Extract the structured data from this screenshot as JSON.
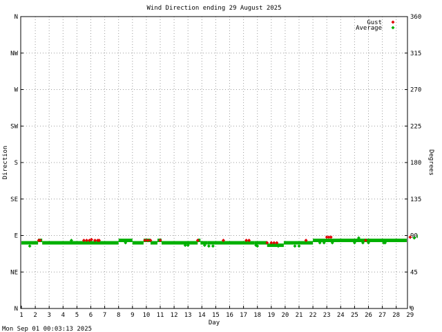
{
  "chart_data": {
    "type": "scatter",
    "title": "Wind Direction ending 29 August 2025",
    "xlabel": "Day",
    "ylabel_left": "Direction",
    "ylabel_right": "Degrees",
    "xlim": [
      1,
      30
    ],
    "ylim": [
      0,
      360
    ],
    "grid": true,
    "legend_position": "top-right",
    "x_ticks": [
      "1",
      "2",
      "3",
      "4",
      "5",
      "6",
      "7",
      "8",
      "9",
      "10",
      "11",
      "12",
      "13",
      "14",
      "15",
      "16",
      "17",
      "18",
      "19",
      "20",
      "21",
      "22",
      "23",
      "24",
      "25",
      "26",
      "27",
      "28",
      "29"
    ],
    "y_ticks_left": [
      {
        "value": 0,
        "label": "N"
      },
      {
        "value": 45,
        "label": "NE"
      },
      {
        "value": 90,
        "label": "E"
      },
      {
        "value": 135,
        "label": "SE"
      },
      {
        "value": 180,
        "label": "S"
      },
      {
        "value": 225,
        "label": "SW"
      },
      {
        "value": 270,
        "label": "W"
      },
      {
        "value": 315,
        "label": "NW"
      },
      {
        "value": 360,
        "label": "N"
      }
    ],
    "y_ticks_right": [
      {
        "value": 0,
        "label": "0"
      },
      {
        "value": 45,
        "label": "45"
      },
      {
        "value": 90,
        "label": "90"
      },
      {
        "value": 135,
        "label": "135"
      },
      {
        "value": 180,
        "label": "180"
      },
      {
        "value": 225,
        "label": "225"
      },
      {
        "value": 270,
        "label": "270"
      },
      {
        "value": 315,
        "label": "315"
      },
      {
        "value": 360,
        "label": "360"
      }
    ],
    "series": [
      {
        "name": "Gust",
        "color": "#e00000",
        "points": [
          [
            2.25,
            84
          ],
          [
            2.35,
            84
          ],
          [
            5.5,
            84
          ],
          [
            5.7,
            84
          ],
          [
            5.9,
            84
          ],
          [
            6.05,
            85
          ],
          [
            6.3,
            84
          ],
          [
            6.5,
            84
          ],
          [
            6.6,
            84
          ],
          [
            9.9,
            84
          ],
          [
            10.1,
            84
          ],
          [
            10.3,
            84
          ],
          [
            11.0,
            84
          ],
          [
            13.7,
            84
          ],
          [
            15.55,
            84
          ],
          [
            17.2,
            84
          ],
          [
            17.4,
            84
          ],
          [
            18.7,
            81
          ],
          [
            19.0,
            81
          ],
          [
            19.2,
            81
          ],
          [
            19.4,
            81
          ],
          [
            21.5,
            84
          ],
          [
            23.0,
            88
          ],
          [
            23.15,
            88
          ],
          [
            23.3,
            88
          ],
          [
            25.8,
            84
          ],
          [
            29.0,
            88
          ]
        ]
      },
      {
        "name": "Average",
        "color": "#00b000",
        "segments": [
          [
            1.0,
            2.2,
            81
          ],
          [
            2.2,
            2.5,
            84
          ],
          [
            2.5,
            8.0,
            81
          ],
          [
            8.0,
            9.0,
            84
          ],
          [
            9.0,
            9.8,
            81
          ],
          [
            9.8,
            10.3,
            84
          ],
          [
            10.3,
            10.8,
            81
          ],
          [
            10.8,
            11.1,
            84
          ],
          [
            11.1,
            13.7,
            81
          ],
          [
            13.7,
            13.9,
            84
          ],
          [
            13.9,
            14.4,
            81
          ],
          [
            14.4,
            17.8,
            81
          ],
          [
            17.8,
            18.7,
            81
          ],
          [
            18.7,
            19.9,
            78
          ],
          [
            19.9,
            22.0,
            81
          ],
          [
            22.0,
            29.0,
            84
          ],
          [
            29.0,
            29.5,
            88
          ],
          [
            29.5,
            30.0,
            89
          ]
        ],
        "points": [
          [
            1.6,
            77
          ],
          [
            4.6,
            84
          ],
          [
            8.5,
            81
          ],
          [
            10.0,
            84
          ],
          [
            10.5,
            81
          ],
          [
            12.8,
            78
          ],
          [
            13.0,
            78
          ],
          [
            14.2,
            78
          ],
          [
            14.5,
            77
          ],
          [
            14.8,
            77
          ],
          [
            17.9,
            78
          ],
          [
            18.0,
            77
          ],
          [
            19.5,
            77
          ],
          [
            20.7,
            77
          ],
          [
            21.0,
            77
          ],
          [
            22.5,
            81
          ],
          [
            22.8,
            81
          ],
          [
            23.4,
            81
          ],
          [
            25.0,
            81
          ],
          [
            25.3,
            87
          ],
          [
            25.6,
            81
          ],
          [
            26.0,
            81
          ],
          [
            27.1,
            81
          ],
          [
            27.2,
            81
          ],
          [
            29.3,
            87
          ]
        ]
      }
    ]
  },
  "footer": {
    "timestamp": "Mon Sep 01 00:03:13 2025"
  }
}
